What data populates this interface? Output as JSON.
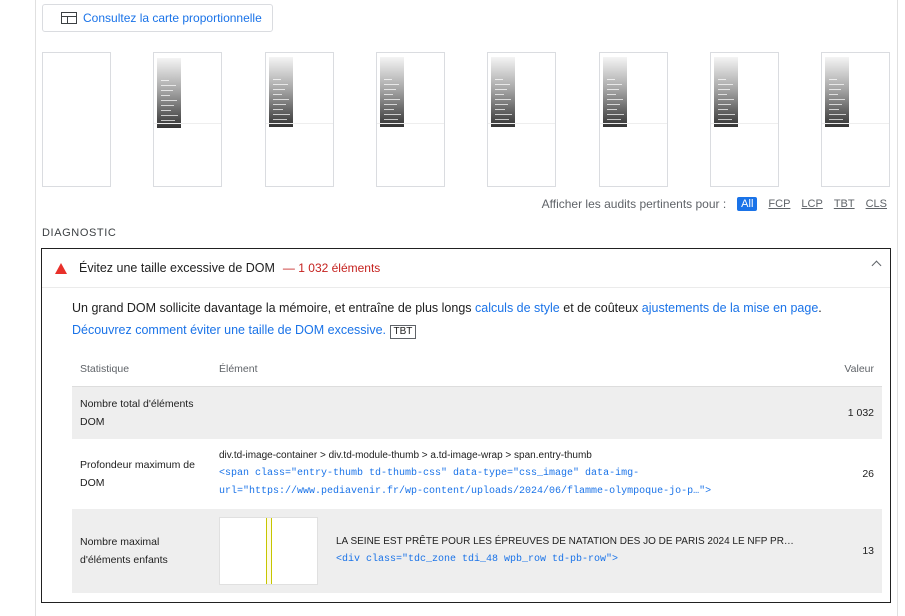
{
  "treemap_button": {
    "label": "Consultez la carte proportionnelle",
    "icon": "treemap-icon"
  },
  "filmstrip": {
    "frames": 8
  },
  "audits_filter": {
    "label": "Afficher les audits pertinents pour :",
    "chips": [
      "All",
      "FCP",
      "LCP",
      "TBT",
      "CLS"
    ],
    "active": "All"
  },
  "section": {
    "title": "DIAGNOSTIC"
  },
  "audit": {
    "title": "Évitez une taille excessive de DOM",
    "display_value": "— 1 032 éléments",
    "description": {
      "part1": "Un grand DOM sollicite davantage la mémoire, et entraîne de plus longs ",
      "link1": "calculs de style",
      "part2": " et de coûteux ",
      "link2": "ajustements de la mise en page",
      "part3": ".",
      "link3": "Découvrez comment éviter une taille de DOM excessive.",
      "tag": "TBT"
    },
    "table": {
      "headers": {
        "stat": "Statistique",
        "element": "Élément",
        "value": "Valeur"
      },
      "rows": [
        {
          "stat": "Nombre total d'éléments DOM",
          "path": "",
          "snippet": "",
          "value": "1 032"
        },
        {
          "stat": "Profondeur maximum de DOM",
          "path": "div.td-image-container > div.td-module-thumb > a.td-image-wrap > span.entry-thumb",
          "snippet": "<span class=\"entry-thumb td-thumb-css\" data-type=\"css_image\" data-img-url=\"https://www.pediavenir.fr/wp-content/uploads/2024/06/flamme-olympoque-jo-p…\">",
          "value": "26"
        },
        {
          "stat": "Nombre maximal d'éléments enfants",
          "path": "LA SEINE EST PRÊTE POUR LES ÉPREUVES DE NATATION DES JO DE PARIS 2024 LE NFP PR…",
          "snippet": "<div class=\"tdc_zone tdi_48 wpb_row td-pb-row\">",
          "value": "13"
        }
      ]
    }
  },
  "colors": {
    "accent": "#1a73e8",
    "warning": "#e8302a",
    "fail_text": "#c5221f"
  }
}
